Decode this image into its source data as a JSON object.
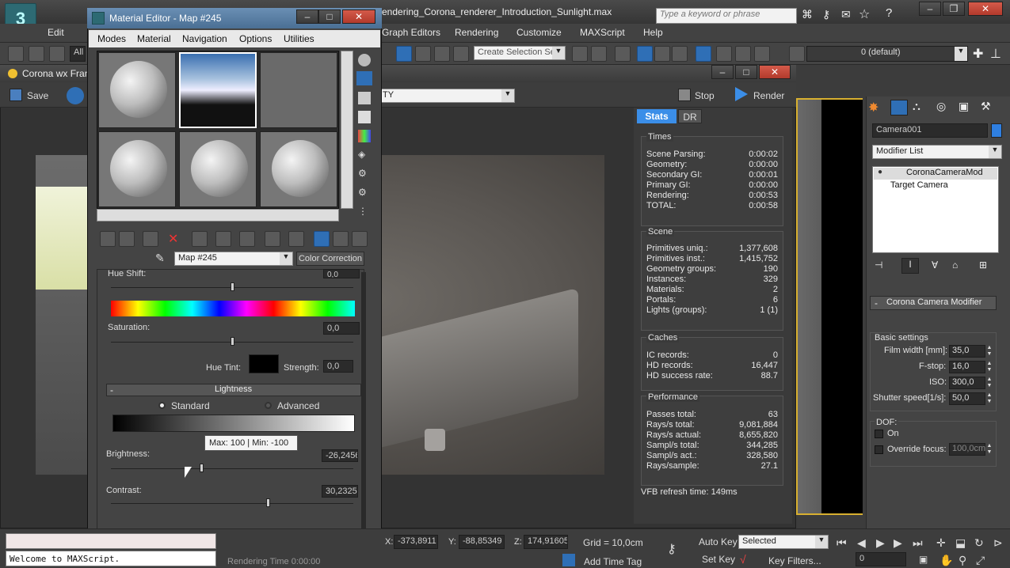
{
  "app": {
    "title": "endering_Corona_renderer_Introduction_Sunlight.max",
    "search_placeholder": "Type a keyword or phrase"
  },
  "menubar": [
    "Edit",
    "Graph Editors",
    "Rendering",
    "Customize",
    "MAXScript",
    "Help"
  ],
  "toolbar": {
    "all_filter": "All",
    "selection_set_placeholder": "Create Selection Se",
    "layer": "0 (default)"
  },
  "corona": {
    "title": "Corona wx Fran",
    "save_label": "Save",
    "channel": "TY",
    "stop_label": "Stop",
    "render_label": "Render",
    "tabs": [
      "Stats",
      "DR"
    ],
    "refresh": "VFB refresh time: 149ms",
    "times_title": "Times",
    "times": [
      {
        "label": "Scene Parsing:",
        "value": "0:00:02"
      },
      {
        "label": "Geometry:",
        "value": "0:00:00"
      },
      {
        "label": "Secondary GI:",
        "value": "0:00:01"
      },
      {
        "label": "Primary GI:",
        "value": "0:00:00"
      },
      {
        "label": "Rendering:",
        "value": "0:00:53"
      },
      {
        "label": "TOTAL:",
        "value": "0:00:58"
      }
    ],
    "scene_title": "Scene",
    "scene": [
      {
        "label": "Primitives uniq.:",
        "value": "1,377,608"
      },
      {
        "label": "Primitives inst.:",
        "value": "1,415,752"
      },
      {
        "label": "Geometry groups:",
        "value": "190"
      },
      {
        "label": "Instances:",
        "value": "329"
      },
      {
        "label": "Materials:",
        "value": "2"
      },
      {
        "label": "Portals:",
        "value": "6"
      },
      {
        "label": "Lights (groups):",
        "value": "1 (1)"
      }
    ],
    "caches_title": "Caches",
    "caches": [
      {
        "label": "IC records:",
        "value": "0"
      },
      {
        "label": "HD records:",
        "value": "16,447"
      },
      {
        "label": "HD success rate:",
        "value": "88.7"
      }
    ],
    "perf_title": "Performance",
    "performance": [
      {
        "label": "Passes total:",
        "value": "63"
      },
      {
        "label": "Rays/s total:",
        "value": "9,081,884"
      },
      {
        "label": "Rays/s actual:",
        "value": "8,655,820"
      },
      {
        "label": "Sampl/s total:",
        "value": "344,285"
      },
      {
        "label": "Sampl/s act.:",
        "value": "328,580"
      },
      {
        "label": "Rays/sample:",
        "value": "27.1"
      }
    ]
  },
  "material_editor": {
    "title": "Material Editor - Map #245",
    "menu": [
      "Modes",
      "Material",
      "Navigation",
      "Options",
      "Utilities"
    ],
    "map_name": "Map #245",
    "map_type": "Color Correction",
    "hue_shift_label": "Hue Shift:",
    "hue_shift": "0,0",
    "saturation_label": "Saturation:",
    "saturation": "0,0",
    "hue_tint_label": "Hue Tint:",
    "strength_label": "Strength:",
    "strength": "0,0",
    "lightness_rollout": "Lightness",
    "rollout_collapse": "-",
    "mode_standard": "Standard",
    "mode_advanced": "Advanced",
    "brightness_label": "Brightness:",
    "brightness": "-26,2456",
    "contrast_label": "Contrast:",
    "contrast": "30,2325",
    "tooltip": "Max: 100 | Min: -100"
  },
  "command_panel": {
    "object_name": "Camera001",
    "modifier_list": "Modifier List",
    "stack": [
      "CoronaCameraMod",
      "Target Camera"
    ],
    "rollout_title": "Corona Camera Modifier",
    "rollout_collapse": "-",
    "basic_settings": "Basic settings",
    "film_width_label": "Film width [mm]:",
    "film_width": "35,0",
    "fstop_label": "F-stop:",
    "fstop": "16,0",
    "iso_label": "ISO:",
    "iso": "300,0",
    "shutter_label": "Shutter speed[1/s]:",
    "shutter": "50,0",
    "dof_label": "DOF:",
    "dof_on": "On",
    "override_focus": "Override focus:",
    "override_focus_value": "100,0cm"
  },
  "status": {
    "listener": "Welcome to MAXScript.",
    "rendering_time": "Rendering Time  0:00:00",
    "x_label": "X:",
    "x": "-373,8911",
    "y_label": "Y:",
    "y": "-88,85349",
    "z_label": "Z:",
    "z": "174,91605",
    "grid": "Grid = 10,0cm",
    "add_time_tag": "Add Time Tag",
    "auto_key": "Auto Key",
    "set_key": "Set Key",
    "key_mode": "Selected",
    "key_filters": "Key Filters...",
    "frame": "0"
  }
}
